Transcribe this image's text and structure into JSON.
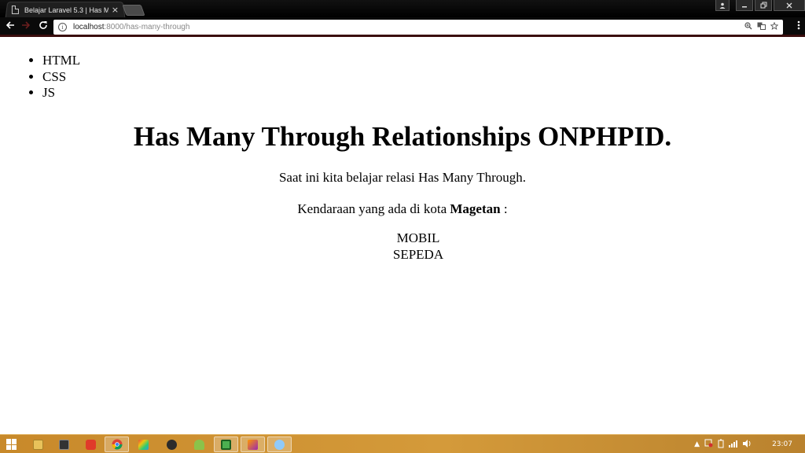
{
  "browser": {
    "tab_title": "Belajar Laravel 5.3 | Has M",
    "tab_close": "×",
    "url_host": "localhost",
    "url_path": ":8000/has-many-through",
    "info_icon": "i",
    "window_controls": [
      "user-icon",
      "minimize-icon",
      "restore-icon",
      "close-icon"
    ]
  },
  "page": {
    "nav_items": [
      "HTML",
      "CSS",
      "JS"
    ],
    "heading": "Has Many Through Relationships ONPHPID.",
    "intro": "Saat ini kita belajar relasi Has Many Through.",
    "vehicles_prefix": "Kendaraan yang ada di kota ",
    "city": "Magetan",
    "vehicles_suffix": " :",
    "vehicles": [
      "MOBIL",
      "SEPEDA"
    ]
  },
  "taskbar": {
    "apps": [
      "file-explorer-icon",
      "terminal-icon",
      "media-icon",
      "chrome-icon",
      "paint-icon",
      "node-icon",
      "android-icon",
      "editor-icon",
      "image-viewer-icon",
      "browser-icon"
    ],
    "clock": "23:07"
  }
}
